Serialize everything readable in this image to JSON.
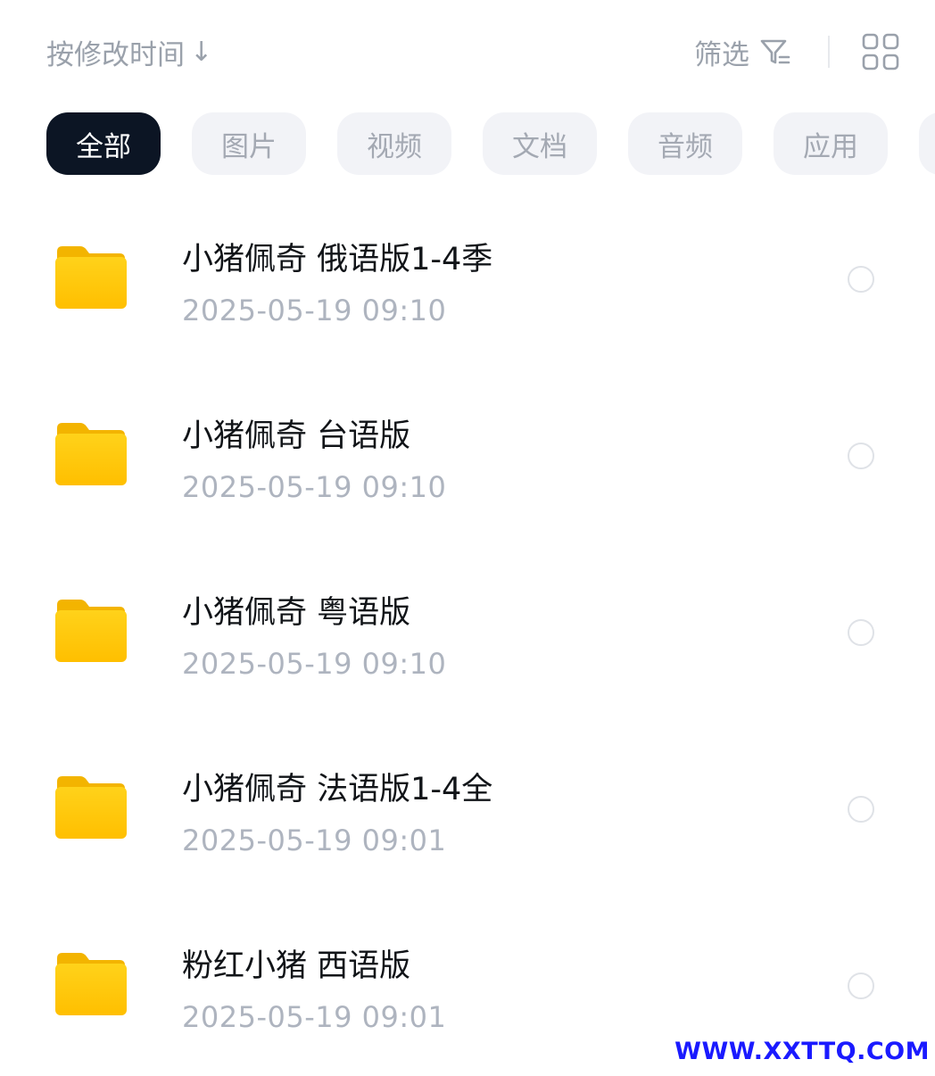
{
  "sort": {
    "label": "按修改时间",
    "direction_icon": "arrow-down-icon"
  },
  "filter": {
    "label": "筛选",
    "icon": "filter-icon",
    "view_toggle_icon": "grid-view-icon"
  },
  "categories": [
    {
      "label": "全部",
      "active": true
    },
    {
      "label": "图片",
      "active": false
    },
    {
      "label": "视频",
      "active": false
    },
    {
      "label": "文档",
      "active": false
    },
    {
      "label": "音频",
      "active": false
    },
    {
      "label": "应用",
      "active": false
    }
  ],
  "files": [
    {
      "name": "小猪佩奇 俄语版1-4季",
      "date": "2025-05-19  09:10",
      "icon": "folder-icon",
      "selected": false
    },
    {
      "name": "小猪佩奇 台语版",
      "date": "2025-05-19  09:10",
      "icon": "folder-icon",
      "selected": false
    },
    {
      "name": "小猪佩奇 粤语版",
      "date": "2025-05-19  09:10",
      "icon": "folder-icon",
      "selected": false
    },
    {
      "name": "小猪佩奇 法语版1-4全",
      "date": "2025-05-19  09:01",
      "icon": "folder-icon",
      "selected": false
    },
    {
      "name": "粉红小猪 西语版",
      "date": "2025-05-19  09:01",
      "icon": "folder-icon",
      "selected": false
    }
  ],
  "watermark": "WWW.XXTTQ.COM",
  "colors": {
    "active_chip": "#0c1524",
    "folder": "#ffc400",
    "watermark": "#1a1aff"
  }
}
